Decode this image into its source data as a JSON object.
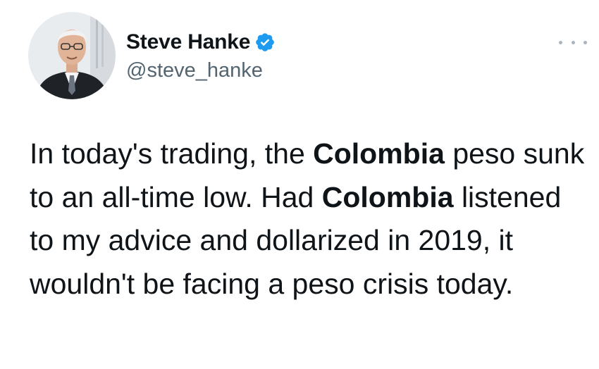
{
  "author": {
    "display_name": "Steve Hanke",
    "handle": "@steve_hanke",
    "verified": true,
    "avatar_icon": "avatar-photo"
  },
  "menu": {
    "icon": "more-options-icon"
  },
  "tweet": {
    "segments": [
      {
        "text": "In today's trading, the ",
        "bold": false
      },
      {
        "text": "Colombia",
        "bold": true
      },
      {
        "text": " peso sunk to an all-time low.  Had ",
        "bold": false
      },
      {
        "text": "Colombia",
        "bold": true
      },
      {
        "text": " listened to my advice and dollarized in 2019, it wouldn't be facing a peso crisis today.",
        "bold": false
      }
    ]
  },
  "colors": {
    "text": "#0f1419",
    "secondary": "#536471",
    "verified_badge": "#1d9bf0"
  }
}
